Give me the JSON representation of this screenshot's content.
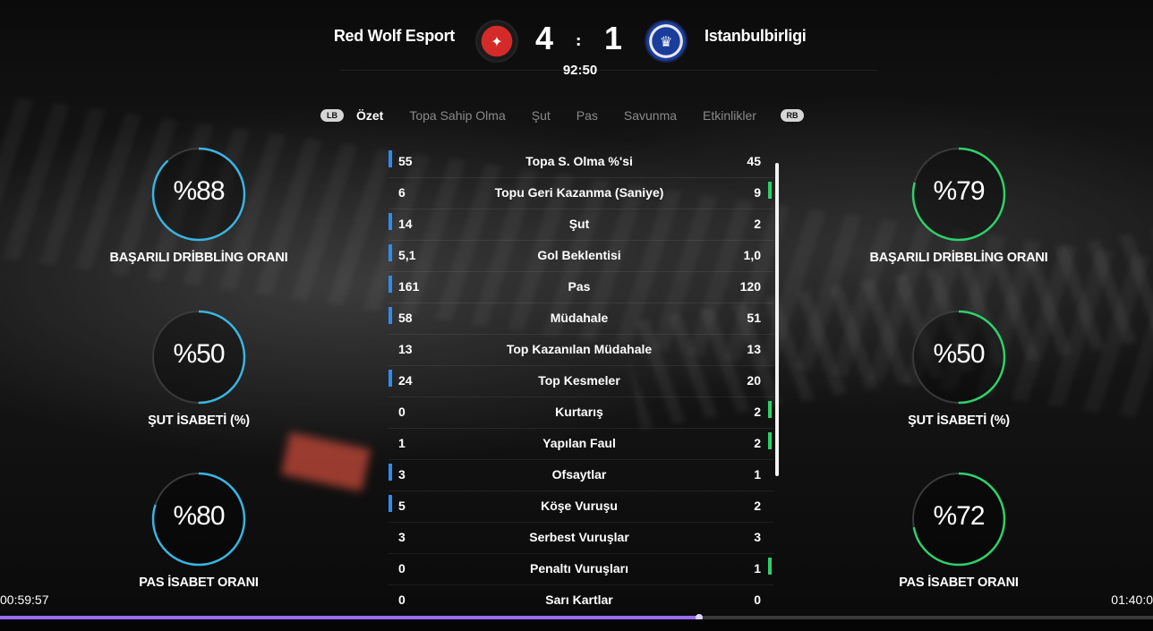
{
  "match": {
    "home_team": "Red Wolf Esport",
    "away_team": "Istanbulbirligi",
    "home_score": "4",
    "away_score": "1",
    "score_separator": ":",
    "clock": "92:50"
  },
  "tabs": {
    "lb": "LB",
    "rb": "RB",
    "items": [
      "Özet",
      "Topa Sahip Olma",
      "Şut",
      "Pas",
      "Savunma",
      "Etkinlikler"
    ],
    "active": "Özet"
  },
  "stats": [
    {
      "label": "Topa S. Olma %'si",
      "home": "55",
      "away": "45",
      "leader": "home"
    },
    {
      "label": "Topu Geri Kazanma (Saniye)",
      "home": "6",
      "away": "9",
      "leader": "away"
    },
    {
      "label": "Şut",
      "home": "14",
      "away": "2",
      "leader": "home"
    },
    {
      "label": "Gol Beklentisi",
      "home": "5,1",
      "away": "1,0",
      "leader": "home"
    },
    {
      "label": "Pas",
      "home": "161",
      "away": "120",
      "leader": "home"
    },
    {
      "label": "Müdahale",
      "home": "58",
      "away": "51",
      "leader": "home"
    },
    {
      "label": "Top Kazanılan Müdahale",
      "home": "13",
      "away": "13",
      "leader": "none"
    },
    {
      "label": "Top Kesmeler",
      "home": "24",
      "away": "20",
      "leader": "home"
    },
    {
      "label": "Kurtarış",
      "home": "0",
      "away": "2",
      "leader": "away"
    },
    {
      "label": "Yapılan Faul",
      "home": "1",
      "away": "2",
      "leader": "away"
    },
    {
      "label": "Ofsaytlar",
      "home": "3",
      "away": "1",
      "leader": "home"
    },
    {
      "label": "Köşe Vuruşu",
      "home": "5",
      "away": "2",
      "leader": "home"
    },
    {
      "label": "Serbest Vuruşlar",
      "home": "3",
      "away": "3",
      "leader": "none"
    },
    {
      "label": "Penaltı Vuruşları",
      "home": "0",
      "away": "1",
      "leader": "away"
    },
    {
      "label": "Sarı Kartlar",
      "home": "0",
      "away": "0",
      "leader": "none"
    }
  ],
  "home_rings": [
    {
      "value": "%88",
      "fraction": 0.88,
      "label": "BAŞARILI DRİBBLİNG ORANI"
    },
    {
      "value": "%50",
      "fraction": 0.5,
      "label": "ŞUT İSABETİ (%)"
    },
    {
      "value": "%80",
      "fraction": 0.8,
      "label": "PAS İSABET ORANI"
    }
  ],
  "away_rings": [
    {
      "value": "%79",
      "fraction": 0.79,
      "label": "BAŞARILI DRİBBLİNG ORANI"
    },
    {
      "value": "%50",
      "fraction": 0.5,
      "label": "ŞUT İSABETİ (%)"
    },
    {
      "value": "%72",
      "fraction": 0.72,
      "label": "PAS İSABET ORANI"
    }
  ],
  "colors": {
    "home_accent": "#2e8cf0",
    "home_ring": "#3ab4e0",
    "away_accent": "#2fd06a",
    "ring_track": "#3a3a3a"
  },
  "video": {
    "elapsed": "00:59:57",
    "total": "01:40:0",
    "progress": 0.606
  }
}
